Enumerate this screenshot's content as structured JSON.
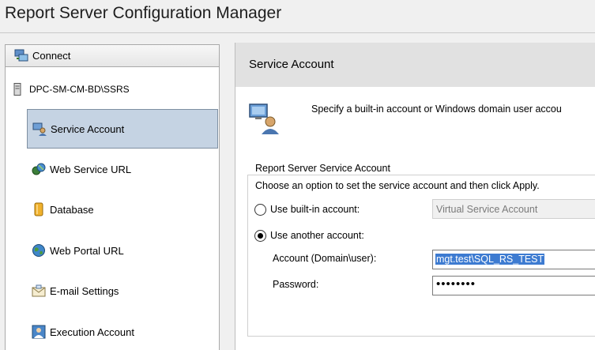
{
  "window": {
    "title": "Report Server Configuration Manager"
  },
  "nav": {
    "connect_label": "Connect",
    "server_name": "DPC-SM-CM-BD\\SSRS",
    "items": [
      {
        "label": "Service Account",
        "icon": "service-account-icon",
        "selected": true
      },
      {
        "label": "Web Service URL",
        "icon": "web-service-url-icon",
        "selected": false
      },
      {
        "label": "Database",
        "icon": "database-icon",
        "selected": false
      },
      {
        "label": "Web Portal URL",
        "icon": "web-portal-url-icon",
        "selected": false
      },
      {
        "label": "E-mail Settings",
        "icon": "email-settings-icon",
        "selected": false
      },
      {
        "label": "Execution Account",
        "icon": "execution-account-icon",
        "selected": false
      }
    ]
  },
  "panel": {
    "header": "Service Account",
    "description": "Specify a built-in account or Windows domain user accou",
    "group": {
      "legend": "Report Server Service Account",
      "note": "Choose an option to set the service account and then click Apply.",
      "builtin_label": "Use built-in account:",
      "builtin_value": "Virtual Service Account",
      "another_label": "Use another account:",
      "account_label": "Account (Domain\\user):",
      "account_value": "mgt.test\\SQL_RS_TEST",
      "password_label": "Password:",
      "password_value": "••••••••",
      "selected_option": "another"
    }
  },
  "colors": {
    "selection": "#c5d3e3",
    "header_bg": "#e1e1e1",
    "text_highlight": "#3d7bd1"
  }
}
